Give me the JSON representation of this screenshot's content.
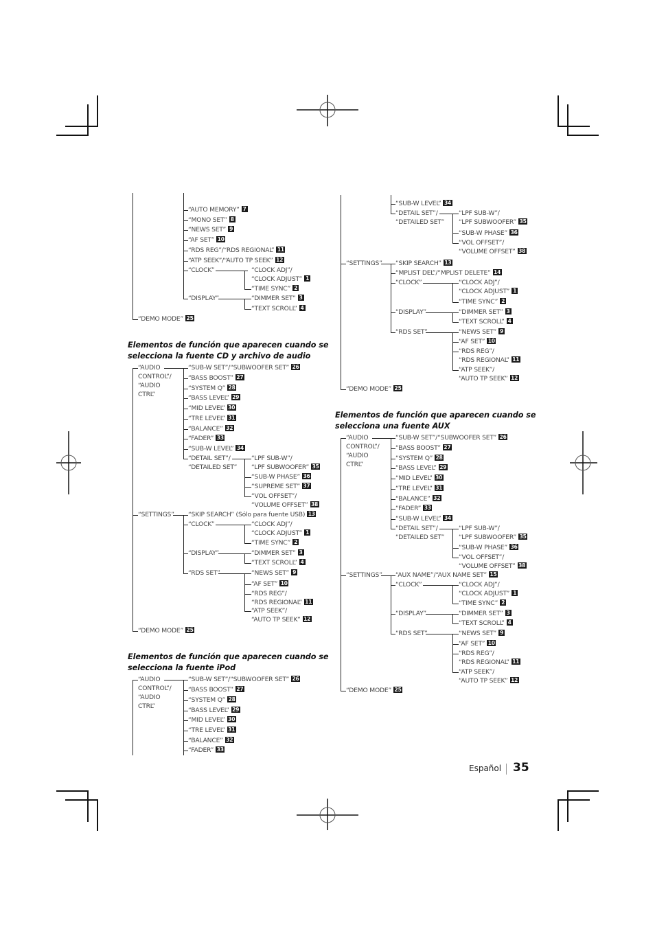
{
  "footer": {
    "language": "Español",
    "page_number": "35"
  },
  "sections": {
    "fm_continued": {
      "items": [
        {
          "label": "“AUTO MEMORY”",
          "badge": "7"
        },
        {
          "label": "“MONO SET”",
          "badge": "8"
        },
        {
          "label": "“NEWS SET”",
          "badge": "9"
        },
        {
          "label": "“AF SET”",
          "badge": "10"
        },
        {
          "label": "“RDS REG”/“RDS REGIONAL”",
          "badge": "11"
        },
        {
          "label": "“ATP SEEK”/“AUTO TP SEEK”",
          "badge": "12"
        }
      ],
      "clock": {
        "label": "“CLOCK”",
        "children": [
          {
            "label": "“CLOCK ADJ”/",
            "label2": "“CLOCK ADJUST”",
            "badge": "1"
          },
          {
            "label": "“TIME SYNC”",
            "badge": "2"
          }
        ]
      },
      "display": {
        "label": "“DISPLAY”",
        "children": [
          {
            "label": "“DIMMER SET”",
            "badge": "3"
          },
          {
            "label": "“TEXT SCROLL”",
            "badge": "4"
          }
        ]
      },
      "demo": {
        "label": "“DEMO MODE”",
        "badge": "25"
      }
    },
    "cd": {
      "heading_line1": "Elementos de función que aparecen cuando se",
      "heading_line2": "selecciona la fuente CD y archivo de audio",
      "audio_control": [
        "“AUDIO",
        "CONTROL”/",
        "“AUDIO",
        "CTRL”"
      ],
      "audio_items": [
        {
          "label": "“SUB-W SET”/“SUBWOOFER SET”",
          "badge": "26"
        },
        {
          "label": "“BASS BOOST”",
          "badge": "27"
        },
        {
          "label": "“SYSTEM Q”",
          "badge": "28"
        },
        {
          "label": "“BASS LEVEL”",
          "badge": "29"
        },
        {
          "label": "“MID LEVEL”",
          "badge": "30"
        },
        {
          "label": "“TRE LEVEL”",
          "badge": "31"
        },
        {
          "label": "“BALANCE”",
          "badge": "32"
        },
        {
          "label": "“FADER”",
          "badge": "33"
        },
        {
          "label": "“SUB-W LEVEL”",
          "badge": "34"
        }
      ],
      "detail_set": {
        "label": "“DETAIL SET”/",
        "label2": "“DETAILED SET”",
        "children": [
          {
            "label": "“LPF SUB-W”/",
            "label2": "“LPF SUBWOOFER”",
            "badge": "35"
          },
          {
            "label": "“SUB-W PHASE”",
            "badge": "36"
          },
          {
            "label": "“SUPREME SET”",
            "badge": "37"
          },
          {
            "label": "“VOL OFFSET”/",
            "label2": "“VOLUME OFFSET”",
            "badge": "38"
          }
        ]
      },
      "settings": "“SETTINGS”",
      "skip_search": {
        "label": "“SKIP SEARCH” (Sólo para fuente USB)",
        "badge": "13"
      },
      "clock": {
        "label": "“CLOCK”",
        "children": [
          {
            "label": "“CLOCK ADJ”/",
            "label2": "“CLOCK ADJUST”",
            "badge": "1"
          },
          {
            "label": "“TIME SYNC”",
            "badge": "2"
          }
        ]
      },
      "display": {
        "label": "“DISPLAY”",
        "children": [
          {
            "label": "“DIMMER SET”",
            "badge": "3"
          },
          {
            "label": "“TEXT SCROLL”",
            "badge": "4"
          }
        ]
      },
      "rds_set": {
        "label": "“RDS SET”",
        "children": [
          {
            "label": "“NEWS SET”",
            "badge": "9"
          },
          {
            "label": "“AF SET”",
            "badge": "10"
          },
          {
            "label": "“RDS REG”/",
            "label2": "“RDS REGIONAL”",
            "badge": "11"
          },
          {
            "label": "“ATP SEEK”/",
            "label2": "“AUTO TP SEEK”",
            "badge": "12"
          }
        ]
      },
      "demo": {
        "label": "“DEMO MODE”",
        "badge": "25"
      }
    },
    "ipod": {
      "heading_line1": "Elementos de función que aparecen cuando se",
      "heading_line2": "selecciona la fuente iPod",
      "audio_control": [
        "“AUDIO",
        "CONTROL”/",
        "“AUDIO",
        "CTRL”"
      ],
      "audio_items": [
        {
          "label": "“SUB-W SET”/“SUBWOOFER SET”",
          "badge": "26"
        },
        {
          "label": "“BASS BOOST”",
          "badge": "27"
        },
        {
          "label": "“SYSTEM Q”",
          "badge": "28"
        },
        {
          "label": "“BASS LEVEL”",
          "badge": "29"
        },
        {
          "label": "“MID LEVEL”",
          "badge": "30"
        },
        {
          "label": "“TRE LEVEL”",
          "badge": "31"
        },
        {
          "label": "“BALANCE”",
          "badge": "32"
        },
        {
          "label": "“FADER”",
          "badge": "33"
        }
      ]
    },
    "ipod_continued": {
      "audio_items": [
        {
          "label": "“SUB-W LEVEL”",
          "badge": "34"
        }
      ],
      "detail_set": {
        "label": "“DETAIL SET”/",
        "label2": "“DETAILED SET”",
        "children": [
          {
            "label": "“LPF SUB-W”/",
            "label2": "“LPF SUBWOOFER”",
            "badge": "35"
          },
          {
            "label": "“SUB-W PHASE”",
            "badge": "36"
          },
          {
            "label": "“VOL OFFSET”/",
            "label2": "“VOLUME OFFSET”",
            "badge": "38"
          }
        ]
      },
      "settings": "“SETTINGS”",
      "skip_search": {
        "label": "“SKIP SEARCH”",
        "badge": "13"
      },
      "mplist": {
        "label": "“MPLIST DEL”/“MPLIST DELETE”",
        "badge": "14"
      },
      "clock": {
        "label": "“CLOCK”",
        "children": [
          {
            "label": "“CLOCK ADJ”/",
            "label2": "“CLOCK ADJUST”",
            "badge": "1"
          },
          {
            "label": "“TIME SYNC”",
            "badge": "2"
          }
        ]
      },
      "display": {
        "label": "“DISPLAY”",
        "children": [
          {
            "label": "“DIMMER SET”",
            "badge": "3"
          },
          {
            "label": "“TEXT SCROLL”",
            "badge": "4"
          }
        ]
      },
      "rds_set": {
        "label": "“RDS SET”",
        "children": [
          {
            "label": "“NEWS SET”",
            "badge": "9"
          },
          {
            "label": "“AF SET”",
            "badge": "10"
          },
          {
            "label": "“RDS REG”/",
            "label2": "“RDS REGIONAL”",
            "badge": "11"
          },
          {
            "label": "“ATP SEEK”/",
            "label2": "“AUTO TP SEEK”",
            "badge": "12"
          }
        ]
      },
      "demo": {
        "label": "“DEMO MODE”",
        "badge": "25"
      }
    },
    "aux": {
      "heading_line1": "Elementos de función que aparecen cuando se",
      "heading_line2": "selecciona una fuente AUX",
      "audio_control": [
        "“AUDIO",
        "CONTROL”/",
        "“AUDIO",
        "CTRL”"
      ],
      "audio_items": [
        {
          "label": "“SUB-W SET”/“SUBWOOFER SET”",
          "badge": "26"
        },
        {
          "label": "“BASS BOOST”",
          "badge": "27"
        },
        {
          "label": "“SYSTEM Q”",
          "badge": "28"
        },
        {
          "label": "“BASS LEVEL”",
          "badge": "29"
        },
        {
          "label": "“MID LEVEL”",
          "badge": "30"
        },
        {
          "label": "“TRE LEVEL”",
          "badge": "31"
        },
        {
          "label": "“BALANCE”",
          "badge": "32"
        },
        {
          "label": "“FADER”",
          "badge": "33"
        },
        {
          "label": "“SUB-W LEVEL”",
          "badge": "34"
        }
      ],
      "detail_set": {
        "label": "“DETAIL SET”/",
        "label2": "“DETAILED SET”",
        "children": [
          {
            "label": "“LPF SUB-W”/",
            "label2": "“LPF SUBWOOFER”",
            "badge": "35"
          },
          {
            "label": "“SUB-W PHASE”",
            "badge": "36"
          },
          {
            "label": "“VOL OFFSET”/",
            "label2": "“VOLUME OFFSET”",
            "badge": "38"
          }
        ]
      },
      "settings": "“SETTINGS”",
      "aux_name": {
        "label": "“AUX NAME”/“AUX NAME SET”",
        "badge": "15"
      },
      "clock": {
        "label": "“CLOCK”",
        "children": [
          {
            "label": "“CLOCK ADJ”/",
            "label2": "“CLOCK ADJUST”",
            "badge": "1"
          },
          {
            "label": "“TIME SYNC”",
            "badge": "2"
          }
        ]
      },
      "display": {
        "label": "“DISPLAY”",
        "children": [
          {
            "label": "“DIMMER SET”",
            "badge": "3"
          },
          {
            "label": "“TEXT SCROLL”",
            "badge": "4"
          }
        ]
      },
      "rds_set": {
        "label": "“RDS SET”",
        "children": [
          {
            "label": "“NEWS SET”",
            "badge": "9"
          },
          {
            "label": "“AF SET”",
            "badge": "10"
          },
          {
            "label": "“RDS REG”/",
            "label2": "“RDS REGIONAL”",
            "badge": "11"
          },
          {
            "label": "“ATP SEEK”/",
            "label2": "“AUTO TP SEEK”",
            "badge": "12"
          }
        ]
      },
      "demo": {
        "label": "“DEMO MODE”",
        "badge": "25"
      }
    }
  }
}
